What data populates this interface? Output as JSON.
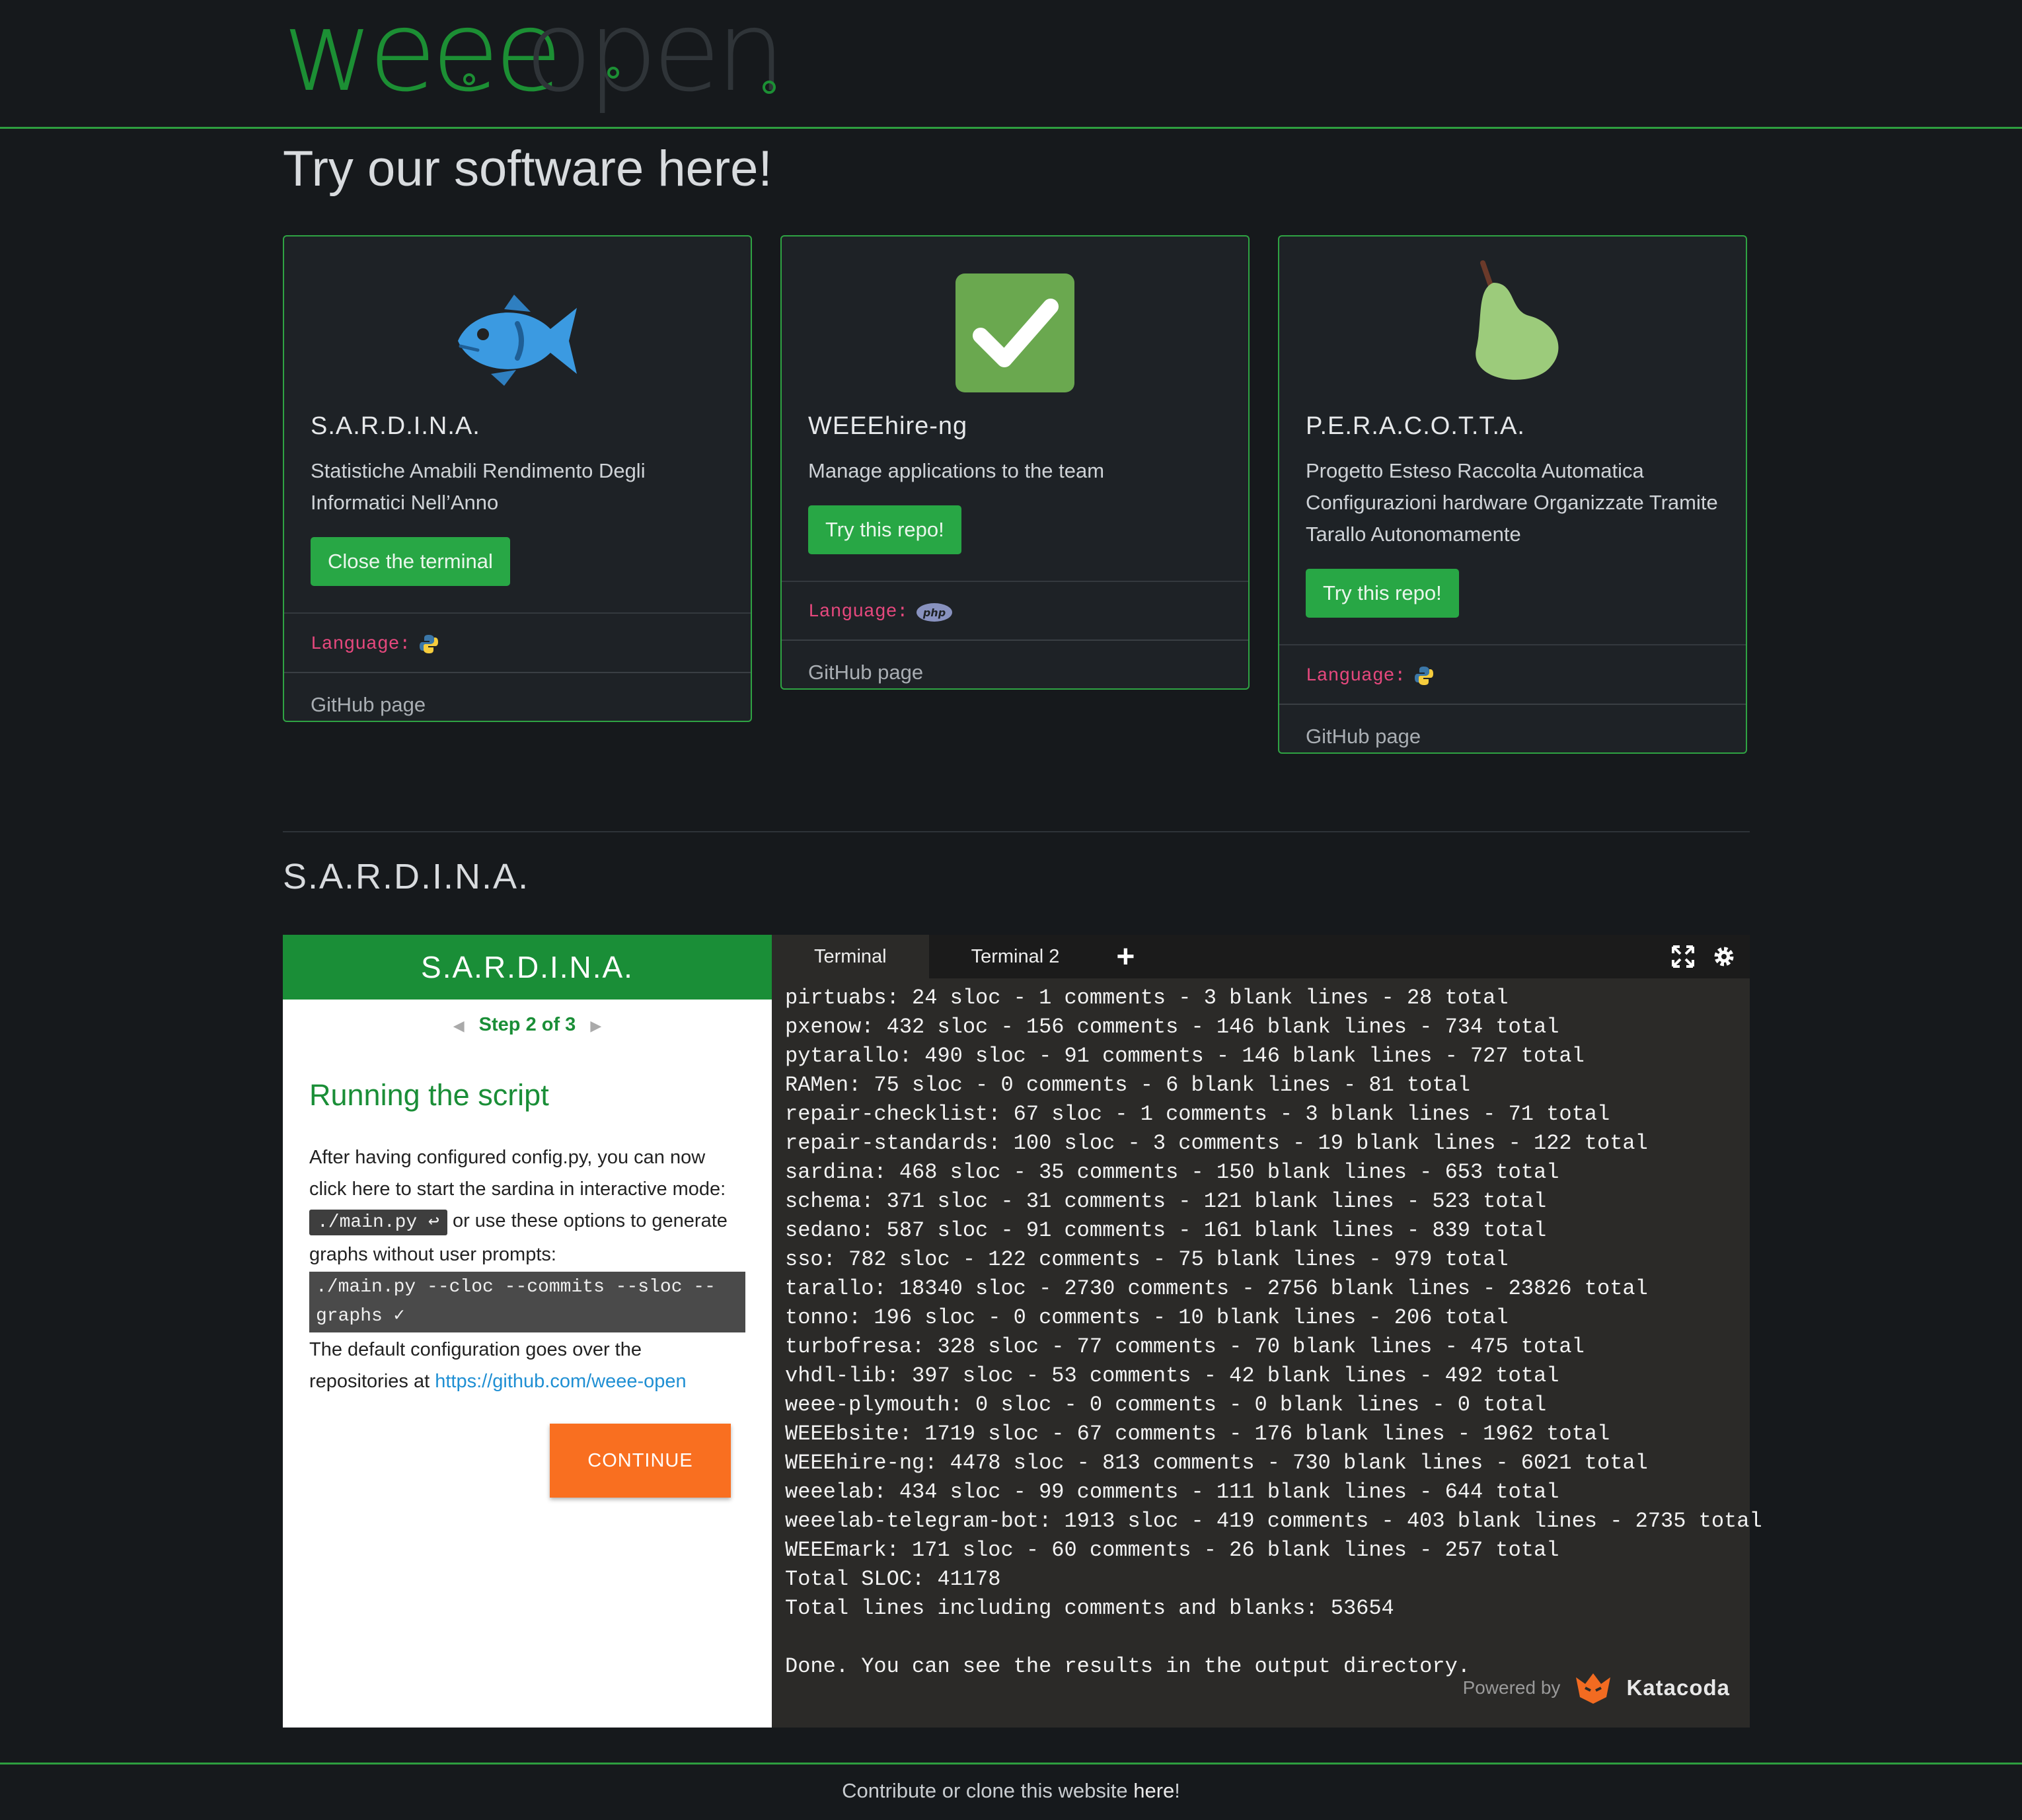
{
  "header": {
    "logo_text": "weeeopen",
    "logo_part1": "weee",
    "logo_part2": "open"
  },
  "page_title": "Try our software here!",
  "colors": {
    "accent_green": "#28a745",
    "border_green": "#2fa343",
    "language_pink": "#e5487d",
    "continue_orange": "#f96f20",
    "background": "#16191c"
  },
  "cards": [
    {
      "icon": "fish-icon",
      "title": "S.A.R.D.I.N.A.",
      "description": "Statistiche Amabili Rendimento Degli Informatici Nell’Anno",
      "button": "Close the terminal",
      "language_label": "Language:",
      "language_icon": "python-icon",
      "github": "GitHub page"
    },
    {
      "icon": "checkmark-icon",
      "title": "WEEEhire-ng",
      "description": "Manage applications to the team",
      "button": "Try this repo!",
      "language_label": "Language:",
      "language_icon": "php-icon",
      "language_badge": "php",
      "github": "GitHub page"
    },
    {
      "icon": "pear-icon",
      "title": "P.E.R.A.C.O.T.T.A.",
      "description": "Progetto Esteso Raccolta Automatica Configurazioni hardware Organizzate Tramite Tarallo Autonomamente",
      "button": "Try this repo!",
      "language_label": "Language:",
      "language_icon": "python-icon",
      "github": "GitHub page"
    }
  ],
  "section_title": "S.A.R.D.I.N.A.",
  "scenario": {
    "title": "S.A.R.D.I.N.A.",
    "step": "Step 2 of 3",
    "heading": "Running the script",
    "text1": "After having configured config.py, you can now click here to start the sardina in interactive mode:",
    "code1": "./main.py ↩",
    "text2": "or use these options to generate graphs without user prompts:",
    "code2": "./main.py --cloc --commits --sloc --graphs ✓",
    "text3": "The default configuration goes over the repositories at",
    "link": "https://github.com/weee-open",
    "continue": "CONTINUE"
  },
  "terminal": {
    "tabs": [
      "Terminal",
      "Terminal 2"
    ],
    "add_tab": "+",
    "lines": [
      "pirtuabs: 24 sloc - 1 comments - 3 blank lines - 28 total",
      "pxenow: 432 sloc - 156 comments - 146 blank lines - 734 total",
      "pytarallo: 490 sloc - 91 comments - 146 blank lines - 727 total",
      "RAMen: 75 sloc - 0 comments - 6 blank lines - 81 total",
      "repair-checklist: 67 sloc - 1 comments - 3 blank lines - 71 total",
      "repair-standards: 100 sloc - 3 comments - 19 blank lines - 122 total",
      "sardina: 468 sloc - 35 comments - 150 blank lines - 653 total",
      "schema: 371 sloc - 31 comments - 121 blank lines - 523 total",
      "sedano: 587 sloc - 91 comments - 161 blank lines - 839 total",
      "sso: 782 sloc - 122 comments - 75 blank lines - 979 total",
      "tarallo: 18340 sloc - 2730 comments - 2756 blank lines - 23826 total",
      "tonno: 196 sloc - 0 comments - 10 blank lines - 206 total",
      "turbofresa: 328 sloc - 77 comments - 70 blank lines - 475 total",
      "vhdl-lib: 397 sloc - 53 comments - 42 blank lines - 492 total",
      "weee-plymouth: 0 sloc - 0 comments - 0 blank lines - 0 total",
      "WEEEbsite: 1719 sloc - 67 comments - 176 blank lines - 1962 total",
      "WEEEhire-ng: 4478 sloc - 813 comments - 730 blank lines - 6021 total",
      "weeelab: 434 sloc - 99 comments - 111 blank lines - 644 total",
      "weeelab-telegram-bot: 1913 sloc - 419 comments - 403 blank lines - 2735 total",
      "WEEEmark: 171 sloc - 60 comments - 26 blank lines - 257 total",
      "Total SLOC: 41178",
      "Total lines including comments and blanks: 53654",
      "",
      "Done. You can see the results in the output directory."
    ],
    "powered_by": "Powered by",
    "brand": "Katacoda"
  },
  "footer": {
    "text": "Contribute or clone this website",
    "link": "here",
    "suffix": "!"
  }
}
